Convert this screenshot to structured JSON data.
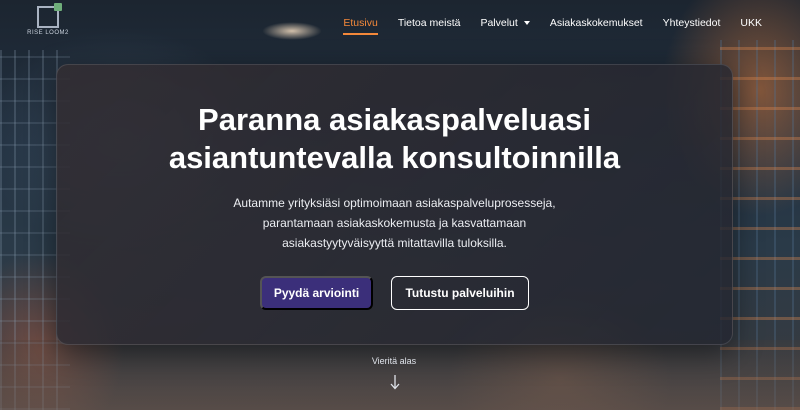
{
  "brand": {
    "logo_text": "RISE LOOM2"
  },
  "nav": {
    "items": [
      {
        "label": "Etusivu",
        "active": true
      },
      {
        "label": "Tietoa meistä"
      },
      {
        "label": "Palvelut",
        "has_dropdown": true
      },
      {
        "label": "Asiakaskokemukset"
      },
      {
        "label": "Yhteystiedot"
      },
      {
        "label": "UKK"
      }
    ],
    "active_color": "#f4883a"
  },
  "hero": {
    "title_line1": "Paranna asiakaspalveluasi",
    "title_line2": "asiantuntevalla konsultoinnilla",
    "subtitle_line1": "Autamme yrityksiäsi optimoimaan asiakaspalveluprosesseja,",
    "subtitle_line2": "parantamaan asiakaskokemusta ja kasvattamaan",
    "subtitle_line3": "asiakastyytyväisyyttä mitattavilla tuloksilla.",
    "primary_button": "Pyydä arviointi",
    "secondary_button": "Tutustu palveluihin",
    "primary_color": "#3b2f7a"
  },
  "scroll": {
    "label": "Vieritä alas",
    "icon": "arrow-down-icon"
  }
}
